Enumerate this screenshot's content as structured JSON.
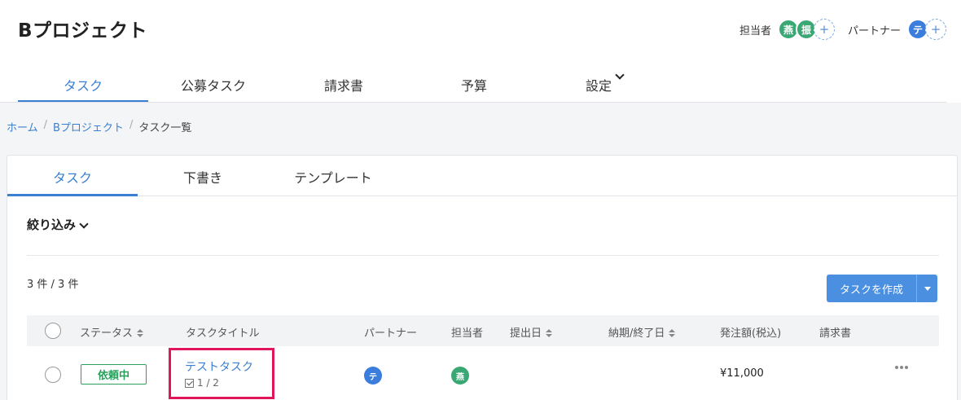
{
  "project": {
    "title": "Bプロジェクト"
  },
  "people": {
    "assignee_label": "担当者",
    "assignees": [
      "燕",
      "振"
    ],
    "partner_label": "パートナー",
    "partners": [
      "テ"
    ],
    "add_symbol": "+"
  },
  "main_tabs": [
    {
      "label": "タスク",
      "active": true
    },
    {
      "label": "公募タスク",
      "active": false
    },
    {
      "label": "請求書",
      "active": false
    },
    {
      "label": "予算",
      "active": false
    },
    {
      "label": "設定",
      "active": false
    }
  ],
  "breadcrumb": {
    "home": "ホーム",
    "project": "Bプロジェクト",
    "current": "タスク一覧",
    "separator": "/"
  },
  "sub_tabs": [
    {
      "label": "タスク",
      "active": true
    },
    {
      "label": "下書き",
      "active": false
    },
    {
      "label": "テンプレート",
      "active": false
    }
  ],
  "filter": {
    "label": "絞り込み"
  },
  "count": {
    "text": "3 件 / 3 件"
  },
  "create_button": {
    "label": "タスクを作成"
  },
  "table": {
    "headers": {
      "status": "ステータス",
      "title": "タスクタイトル",
      "partner": "パートナー",
      "assignee": "担当者",
      "submit_date": "提出日",
      "due_date": "納期/終了日",
      "amount": "発注額(税込)",
      "invoice": "請求書"
    },
    "rows": [
      {
        "status": "依頼中",
        "title": "テストタスク",
        "subtasks": "1 / 2",
        "partner": "テ",
        "assignee": "燕",
        "submit_date": "",
        "due_date": "",
        "amount": "¥11,000",
        "invoice": ""
      }
    ]
  },
  "colors": {
    "accent": "#3a7fd1",
    "status_green": "#2aa05c",
    "highlight": "#e0155b",
    "avatar_green": "#3aa874",
    "avatar_blue": "#3b7ddd"
  }
}
